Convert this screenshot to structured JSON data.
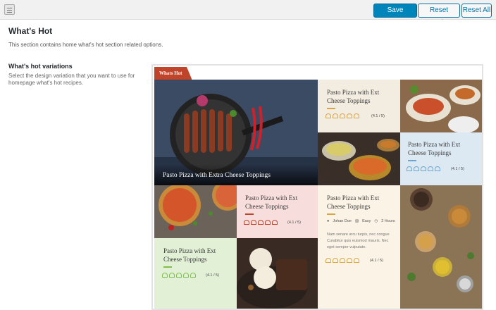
{
  "toolbar": {
    "save_label": "Save Changes",
    "reset_section_label": "Reset Section",
    "reset_all_label": "Reset All"
  },
  "section": {
    "title": "What's Hot",
    "description": "This section contains home what's hot section related options."
  },
  "field": {
    "title": "What's hot variations",
    "description": "Select the design variation that you want to use for homepage what's hot recipes."
  },
  "preview": {
    "label": "Whats Hot",
    "cards": [
      {
        "title": "Pasto Pizza with Extra Cheese Toppings"
      },
      {
        "title": "Pasto Pizza with Ext Cheese Toppings",
        "rating": "(4.1 / 5)"
      },
      {
        "title": "Pasto Pizza with Ext Cheese Toppings",
        "rating": "(4.1 / 5)"
      },
      {
        "title": "Pasto Pizza with Ext Cheese Toppings",
        "rating": "(4.1 / 5)"
      },
      {
        "title": "Pasto Pizza with Ext Cheese Toppings",
        "author": "Johan Doe",
        "difficulty": "Easy",
        "time": "2 Hours",
        "excerpt": "Nam senare arcu turpis, nec congue Curabitur quis euismod mauris. Nec eget semper vulputate.",
        "rating": "(4.1 / 5)"
      },
      {
        "title": "Pasto Pizza with Ext Cheese Toppings",
        "rating": "(4.1 / 5)"
      }
    ],
    "colors": {
      "orange": "#d9a443",
      "blue": "#6aa6cf",
      "red": "#c0442a",
      "green": "#7fbf4e"
    }
  }
}
